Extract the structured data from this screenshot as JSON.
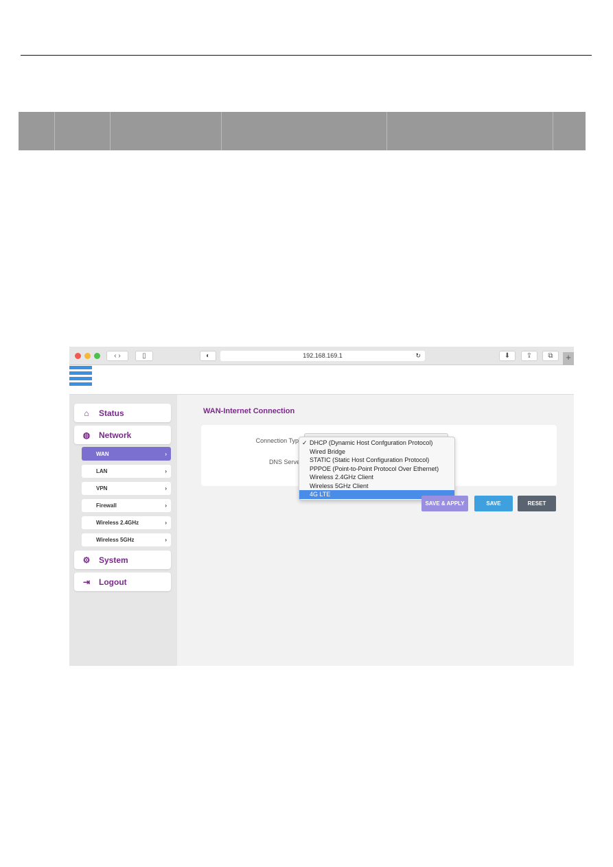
{
  "browser": {
    "url": "192.168.169.1"
  },
  "sidebar": {
    "items": [
      {
        "label": "Status",
        "icon": "home-icon"
      },
      {
        "label": "Network",
        "icon": "globe-icon"
      },
      {
        "label": "System",
        "icon": "gears-icon"
      },
      {
        "label": "Logout",
        "icon": "logout-icon"
      }
    ],
    "network_sub": [
      "WAN",
      "LAN",
      "VPN",
      "Firewall",
      "Wireless 2.4GHz",
      "Wireless 5GHz"
    ],
    "active": "WAN"
  },
  "main": {
    "title": "WAN-Internet Connection",
    "connection_type_label": "Connection Type",
    "dns_label": "DNS Server",
    "options": [
      "DHCP (Dynamic Host Confguration Protocol)",
      "Wired Bridge",
      "STATIC (Static Host Configuration Protocol)",
      "PPPOE (Point-to-Point Protocol Over Ethernet)",
      "Wireless 2.4GHz Client",
      "Wireless 5GHz Client",
      "4G LTE"
    ],
    "checked_option": "DHCP (Dynamic Host Confguration Protocol)",
    "highlighted_option": "4G LTE",
    "buttons": {
      "save_apply": "SAVE & APPLY",
      "save": "SAVE",
      "reset": "RESET"
    }
  },
  "colors": {
    "accent": "#7a2a8a",
    "active": "#7b6fd0",
    "save": "#3fa0e0",
    "reset": "#5a6470",
    "highlight": "#4a8de8"
  }
}
